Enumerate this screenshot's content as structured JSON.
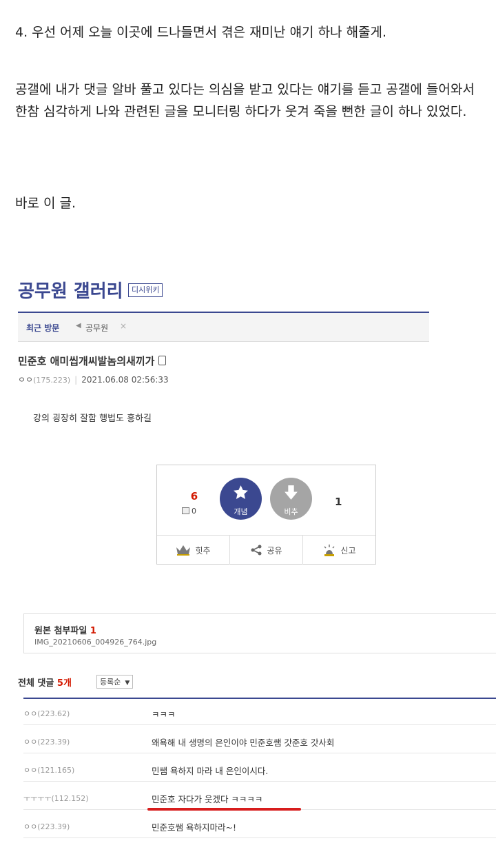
{
  "intro": {
    "p1": "4. 우선 어제 오늘 이곳에 드나들면서 겪은 재미난 얘기 하나 해줄게.",
    "p2": "공갤에 내가 댓글 알바 풀고 있다는 의심을 받고 있다는 얘기를 듣고 공갤에 들어와서 한참 심각하게 나와 관련된 글을 모니터링 하다가 웃겨 죽을 뻔한 글이 하나 있었다.",
    "p3": "바로 이 글."
  },
  "gallery": {
    "title": "공무원 갤러리",
    "wiki_badge": "디시위키",
    "recent_label": "최근 방문",
    "recent_arrow": "◀",
    "recent_item": "공무원",
    "recent_close": "×"
  },
  "post": {
    "title": "민준호 애미씹개씨발놈의새끼가",
    "author": "ㅇㅇ",
    "author_ip": "(175.223)",
    "date": "2021.06.08 02:56:33",
    "body": "강의 굉장히 잘함 행법도 흥하길"
  },
  "vote": {
    "up_count": "6",
    "fix_count": "0",
    "up_label": "개념",
    "down_label": "비추",
    "down_count": "1",
    "hit_label": "힛추",
    "share_label": "공유",
    "report_label": "신고"
  },
  "attachment": {
    "title": "원본 첨부파일",
    "count": "1",
    "filename": "IMG_20210606_004926_764.jpg"
  },
  "comments": {
    "header_label": "전체 댓글",
    "count": "5개",
    "sort_label": "등록순",
    "sort_arrow": "▼",
    "items": [
      {
        "nick": "ㅇㅇ",
        "ip": "(223.62)",
        "text": "ㅋㅋㅋ"
      },
      {
        "nick": "ㅇㅇ",
        "ip": "(223.39)",
        "text": "왜욕해 내 생명의 은인이야 민준호쌤 갓준호 갓사회"
      },
      {
        "nick": "ㅇㅇ",
        "ip": "(121.165)",
        "text": "민쌤 욕하지 마라 내 은인이시다."
      },
      {
        "nick": "ㅜㅜㅜㅜ",
        "ip": "(112.152)",
        "text": "민준호 자다가 웃겠다 ㅋㅋㅋㅋ"
      },
      {
        "nick": "ㅇㅇ",
        "ip": "(223.39)",
        "text": "민준호쌤 욕하지마라~!"
      }
    ]
  },
  "colors": {
    "brand": "#3b4890",
    "accent_red": "#d31900",
    "underline": "#d71d1d"
  }
}
